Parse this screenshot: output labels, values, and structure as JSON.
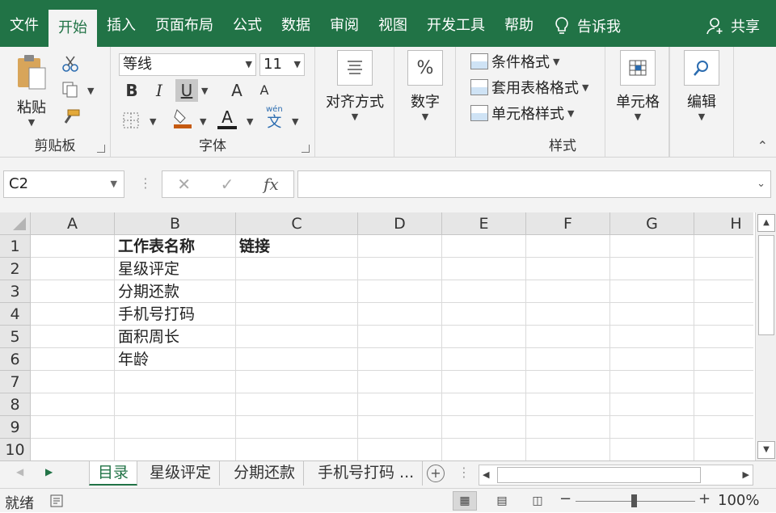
{
  "ribbon_tabs": [
    "文件",
    "开始",
    "插入",
    "页面布局",
    "公式",
    "数据",
    "审阅",
    "视图",
    "开发工具",
    "帮助"
  ],
  "active_tab_index": 1,
  "tell_me": "告诉我",
  "share": "共享",
  "clipboard": {
    "paste": "粘贴",
    "group_label": "剪贴板"
  },
  "font": {
    "name": "等线",
    "size": "11",
    "bold": "B",
    "italic": "I",
    "underline": "U",
    "grow": "A",
    "shrink": "A",
    "color_letter": "A",
    "phonetic": "wén",
    "phonetic_char": "文",
    "group_label": "字体"
  },
  "alignment": {
    "label": "对齐方式"
  },
  "number": {
    "label": "数字",
    "icon": "%"
  },
  "styles": {
    "conditional": "条件格式",
    "table": "套用表格格式",
    "cell_styles": "单元格样式",
    "group_label": "样式"
  },
  "cells": {
    "label": "单元格"
  },
  "editing": {
    "label": "编辑"
  },
  "formula_bar": {
    "name_box": "C2",
    "fx": "fx",
    "content": ""
  },
  "columns": [
    "A",
    "B",
    "C",
    "D",
    "E",
    "F",
    "G",
    "H"
  ],
  "rows": [
    {
      "num": "1",
      "A": "",
      "B": "工作表名称",
      "C": "链接"
    },
    {
      "num": "2",
      "A": "",
      "B": "星级评定",
      "C": ""
    },
    {
      "num": "3",
      "A": "",
      "B": "分期还款",
      "C": ""
    },
    {
      "num": "4",
      "A": "",
      "B": "手机号打码",
      "C": ""
    },
    {
      "num": "5",
      "A": "",
      "B": "面积周长",
      "C": ""
    },
    {
      "num": "6",
      "A": "",
      "B": "年龄",
      "C": ""
    },
    {
      "num": "7",
      "A": "",
      "B": "",
      "C": ""
    },
    {
      "num": "8",
      "A": "",
      "B": "",
      "C": ""
    },
    {
      "num": "9",
      "A": "",
      "B": "",
      "C": ""
    },
    {
      "num": "10",
      "A": "",
      "B": "",
      "C": ""
    }
  ],
  "sheets": [
    "目录",
    "星级评定",
    "分期还款",
    "手机号打码 ..."
  ],
  "active_sheet_index": 0,
  "status": {
    "ready": "就绪",
    "zoom": "100%"
  },
  "colors": {
    "accent": "#217346"
  }
}
